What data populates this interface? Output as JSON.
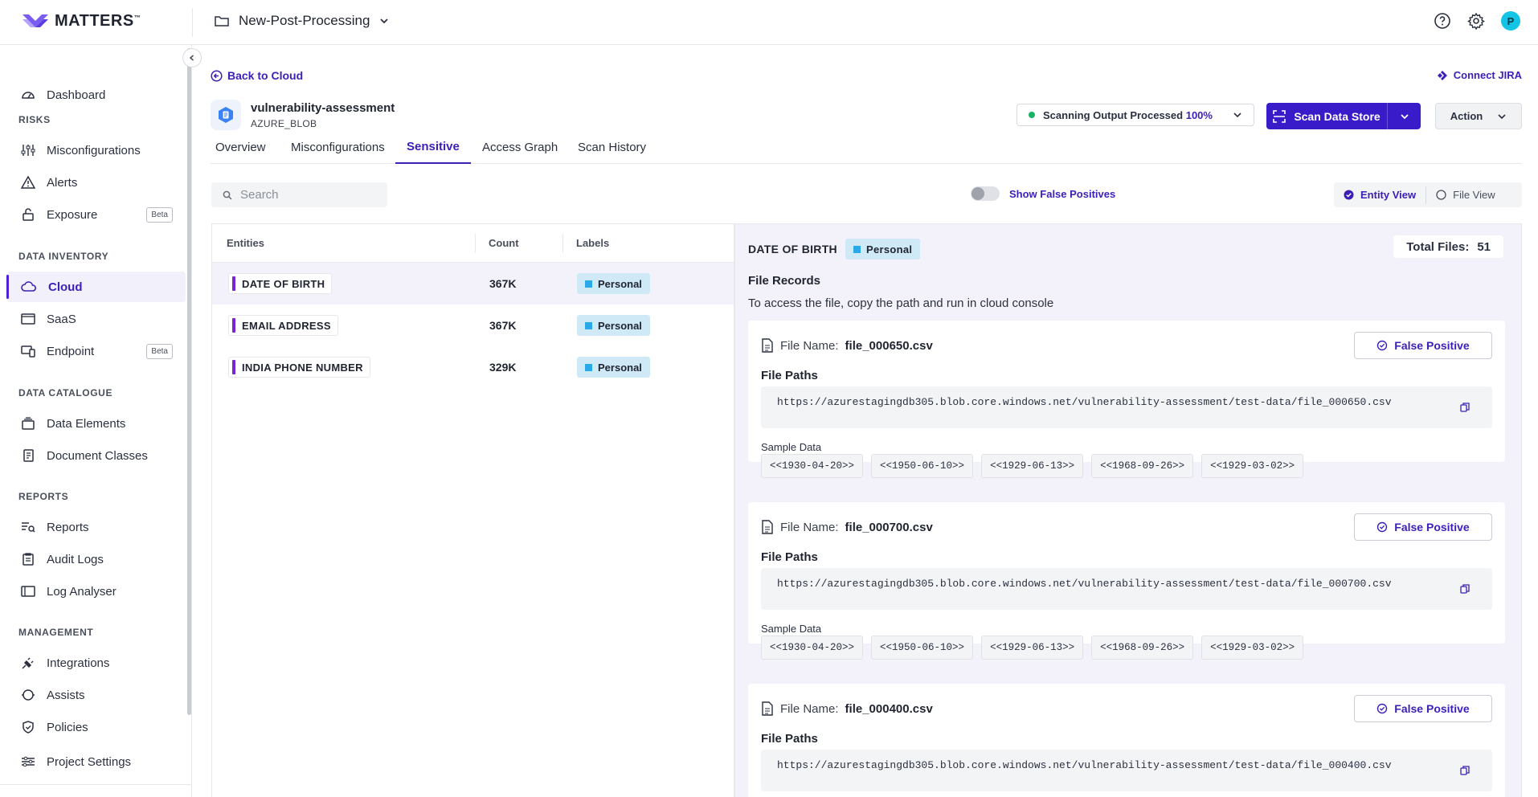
{
  "brand": {
    "name": "MATTERS",
    "tm": "™"
  },
  "project": {
    "name": "New-Post-Processing"
  },
  "user": {
    "initial": "P"
  },
  "sidebar": {
    "items_top": [
      {
        "label": "Dashboard"
      }
    ],
    "sections": [
      {
        "title": "RISKS",
        "items": [
          {
            "label": "Misconfigurations"
          },
          {
            "label": "Alerts"
          },
          {
            "label": "Exposure",
            "badge": "Beta"
          }
        ]
      },
      {
        "title": "DATA INVENTORY",
        "items": [
          {
            "label": "Cloud"
          },
          {
            "label": "SaaS"
          },
          {
            "label": "Endpoint",
            "badge": "Beta"
          }
        ]
      },
      {
        "title": "DATA CATALOGUE",
        "items": [
          {
            "label": "Data Elements"
          },
          {
            "label": "Document Classes"
          }
        ]
      },
      {
        "title": "REPORTS",
        "items": [
          {
            "label": "Reports"
          },
          {
            "label": "Audit Logs"
          },
          {
            "label": "Log Analyser"
          }
        ]
      },
      {
        "title": "MANAGEMENT",
        "items": [
          {
            "label": "Integrations"
          },
          {
            "label": "Assists"
          },
          {
            "label": "Policies"
          }
        ]
      }
    ],
    "bottom": {
      "label": "Project Settings"
    }
  },
  "header": {
    "back_label": "Back to Cloud",
    "jira_label": "Connect JIRA",
    "asset_name": "vulnerability-assessment",
    "asset_type": "AZURE_BLOB",
    "scan_status": "Scanning Output Processed",
    "scan_pct": "100%",
    "scan_button": "Scan Data Store",
    "action_label": "Action"
  },
  "tabs": [
    {
      "label": "Overview"
    },
    {
      "label": "Misconfigurations"
    },
    {
      "label": "Sensitive"
    },
    {
      "label": "Access Graph"
    },
    {
      "label": "Scan History"
    }
  ],
  "active_tab": "Sensitive",
  "toolbar": {
    "search_placeholder": "Search",
    "false_positive_toggle": "Show False Positives",
    "entity_view": "Entity View",
    "file_view": "File View"
  },
  "entities": {
    "columns": [
      "Entities",
      "Count",
      "Labels"
    ],
    "rows": [
      {
        "name": "DATE OF BIRTH",
        "count": "367K",
        "label": "Personal"
      },
      {
        "name": "EMAIL ADDRESS",
        "count": "367K",
        "label": "Personal"
      },
      {
        "name": "INDIA PHONE NUMBER",
        "count": "329K",
        "label": "Personal"
      }
    ]
  },
  "detail": {
    "entity": "DATE OF BIRTH",
    "label": "Personal",
    "total_files_label": "Total Files:",
    "total_files": "51",
    "records_title": "File Records",
    "records_hint": "To access the file, copy the path and run in cloud console",
    "file_name_label": "File Name:",
    "file_paths_label": "File Paths",
    "sample_data_label": "Sample Data",
    "false_positive_label": "False Positive",
    "files": [
      {
        "name": "file_000650.csv",
        "path": "https://azurestagingdb305.blob.core.windows.net/vulnerability-assessment/test-data/file_000650.csv",
        "samples": [
          "<<1930-04-20>>",
          "<<1950-06-10>>",
          "<<1929-06-13>>",
          "<<1968-09-26>>",
          "<<1929-03-02>>"
        ]
      },
      {
        "name": "file_000700.csv",
        "path": "https://azurestagingdb305.blob.core.windows.net/vulnerability-assessment/test-data/file_000700.csv",
        "samples": [
          "<<1930-04-20>>",
          "<<1950-06-10>>",
          "<<1929-06-13>>",
          "<<1968-09-26>>",
          "<<1929-03-02>>"
        ]
      },
      {
        "name": "file_000400.csv",
        "path": "https://azurestagingdb305.blob.core.windows.net/vulnerability-assessment/test-data/file_000400.csv",
        "samples": []
      }
    ]
  },
  "colors": {
    "accent": "#3d1fb8",
    "button": "#3a1bc9",
    "status_ok": "#16b364",
    "label_bg": "#cfe9f7",
    "entity_bar": "#7b22d4"
  }
}
